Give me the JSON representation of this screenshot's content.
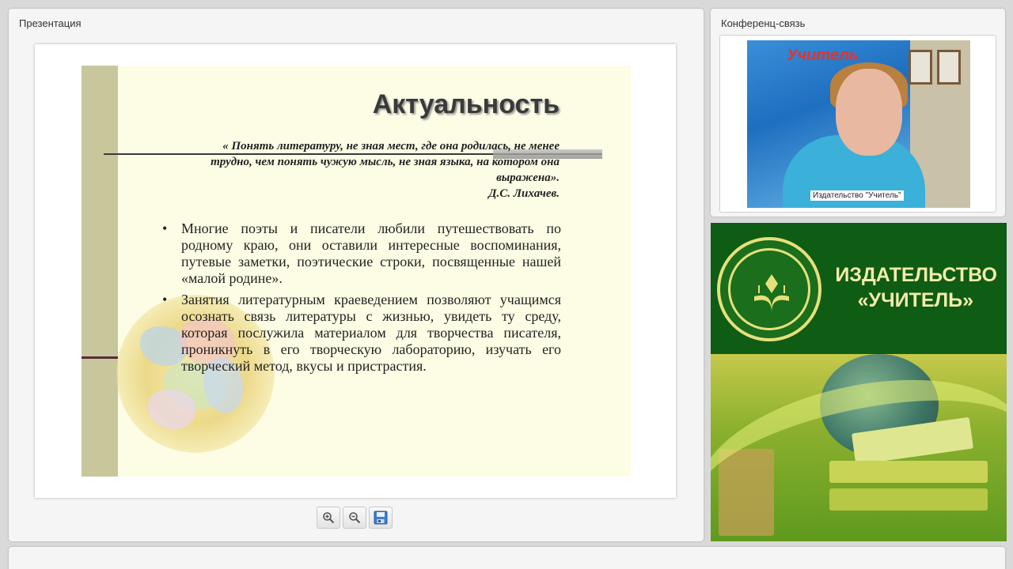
{
  "presentation": {
    "title": "Презентация",
    "slide": {
      "heading": "Актуальность",
      "quote": "« Понять литературу, не зная мест, где она родилась, не менее трудно, чем понять чужую мысль, не зная языка, на котором она выражена».",
      "quote_author": "Д.С. Лихачев.",
      "bullets": [
        "Многие поэты и писатели любили путешествовать по родному краю, они оставили интересные воспоминания, путевые заметки, поэтические строки, посвященные нашей «малой родине».",
        "Занятия литературным краеведением позволяют учащимся осознать связь литературы с жизнью, увидеть ту среду, которая послужила материалом для творчества писателя, проникнуть в его творческую лабораторию, изучать его творческий метод, вкусы и пристрастия."
      ],
      "bullet_symbol": "•"
    },
    "toolbar": {
      "zoom_in_icon": "zoom-in-icon",
      "zoom_out_icon": "zoom-out-icon",
      "save_icon": "save-icon"
    }
  },
  "conference": {
    "title": "Конференц-связь",
    "banner_text": "Учитель",
    "caption": "Издательство \"Учитель\""
  },
  "ad": {
    "line1": "ИЗДАТЕЛЬСТВО",
    "line2": "«УЧИТЕЛЬ»",
    "colors": {
      "green": "#0f5c14",
      "gold": "#f2ecac"
    }
  }
}
